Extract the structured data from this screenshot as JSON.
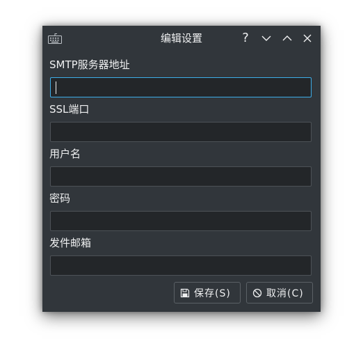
{
  "window": {
    "title": "编辑设置",
    "help_label": "?"
  },
  "form": {
    "fields": [
      {
        "label": "SMTP服务器地址",
        "value": ""
      },
      {
        "label": "SSL端口",
        "value": ""
      },
      {
        "label": "用户名",
        "value": ""
      },
      {
        "label": "密码",
        "value": ""
      },
      {
        "label": "发件邮箱",
        "value": ""
      }
    ]
  },
  "buttons": {
    "save_label": "保存(S)",
    "cancel_label": "取消(C)"
  },
  "icons": {
    "app": "keyboard-icon",
    "save": "floppy-disk-icon",
    "cancel": "no-entry-icon"
  },
  "colors": {
    "window_bg": "#31363b",
    "input_bg": "#232629",
    "focus_accent": "#3daee9",
    "text": "#eff0f1"
  }
}
